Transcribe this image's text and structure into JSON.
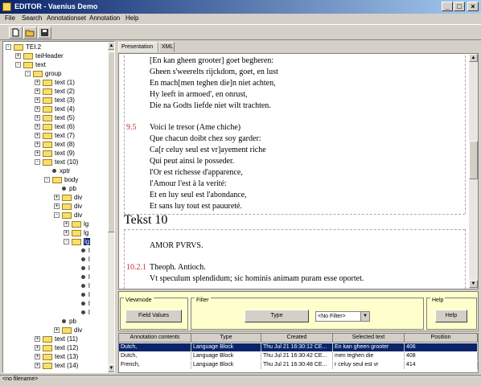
{
  "window": {
    "title": "EDITOR - Vaenius Demo"
  },
  "menu": [
    "File",
    "Search",
    "Annotationset",
    "Annotation",
    "Help"
  ],
  "tree": {
    "nodes": [
      {
        "label": "TEI.2",
        "depth": 0,
        "kind": "folder",
        "exp": "-"
      },
      {
        "label": "teiHeader",
        "depth": 1,
        "kind": "folder",
        "exp": "+"
      },
      {
        "label": "text",
        "depth": 1,
        "kind": "folder",
        "exp": "-"
      },
      {
        "label": "group",
        "depth": 2,
        "kind": "folder",
        "exp": "-"
      },
      {
        "label": "text (1)",
        "depth": 3,
        "kind": "folder",
        "exp": "+"
      },
      {
        "label": "text (2)",
        "depth": 3,
        "kind": "folder",
        "exp": "+"
      },
      {
        "label": "text (3)",
        "depth": 3,
        "kind": "folder",
        "exp": "+"
      },
      {
        "label": "text (4)",
        "depth": 3,
        "kind": "folder",
        "exp": "+"
      },
      {
        "label": "text (5)",
        "depth": 3,
        "kind": "folder",
        "exp": "+"
      },
      {
        "label": "text (6)",
        "depth": 3,
        "kind": "folder",
        "exp": "+"
      },
      {
        "label": "text (7)",
        "depth": 3,
        "kind": "folder",
        "exp": "+"
      },
      {
        "label": "text (8)",
        "depth": 3,
        "kind": "folder",
        "exp": "+"
      },
      {
        "label": "text (9)",
        "depth": 3,
        "kind": "folder",
        "exp": "+"
      },
      {
        "label": "text (10)",
        "depth": 3,
        "kind": "folder",
        "exp": "-"
      },
      {
        "label": "xptr",
        "depth": 4,
        "kind": "leaf",
        "exp": ""
      },
      {
        "label": "body",
        "depth": 4,
        "kind": "folder",
        "exp": "-"
      },
      {
        "label": "pb",
        "depth": 5,
        "kind": "leaf",
        "exp": ""
      },
      {
        "label": "div",
        "depth": 5,
        "kind": "folder",
        "exp": "+"
      },
      {
        "label": "div",
        "depth": 5,
        "kind": "folder",
        "exp": "+"
      },
      {
        "label": "div",
        "depth": 5,
        "kind": "folder",
        "exp": "-"
      },
      {
        "label": "lg",
        "depth": 6,
        "kind": "folder",
        "exp": "+"
      },
      {
        "label": "lg",
        "depth": 6,
        "kind": "folder",
        "exp": "+"
      },
      {
        "label": "lg",
        "depth": 6,
        "kind": "folder",
        "exp": "-",
        "selected": true
      },
      {
        "label": "l",
        "depth": 7,
        "kind": "leaf",
        "exp": ""
      },
      {
        "label": "l",
        "depth": 7,
        "kind": "leaf",
        "exp": ""
      },
      {
        "label": "l",
        "depth": 7,
        "kind": "leaf",
        "exp": ""
      },
      {
        "label": "l",
        "depth": 7,
        "kind": "leaf",
        "exp": ""
      },
      {
        "label": "l",
        "depth": 7,
        "kind": "leaf",
        "exp": ""
      },
      {
        "label": "l",
        "depth": 7,
        "kind": "leaf",
        "exp": ""
      },
      {
        "label": "l",
        "depth": 7,
        "kind": "leaf",
        "exp": ""
      },
      {
        "label": "l",
        "depth": 7,
        "kind": "leaf",
        "exp": ""
      },
      {
        "label": "pb",
        "depth": 5,
        "kind": "leaf",
        "exp": ""
      },
      {
        "label": "div",
        "depth": 5,
        "kind": "folder",
        "exp": "+"
      },
      {
        "label": "text (11)",
        "depth": 3,
        "kind": "folder",
        "exp": "+"
      },
      {
        "label": "text (12)",
        "depth": 3,
        "kind": "folder",
        "exp": "+"
      },
      {
        "label": "text (13)",
        "depth": 3,
        "kind": "folder",
        "exp": "+"
      },
      {
        "label": "text (14)",
        "depth": 3,
        "kind": "folder",
        "exp": "+"
      }
    ]
  },
  "tabs": [
    "Presentation",
    "XML"
  ],
  "document": {
    "block1": [
      "[En kan gheen grooter] goet begheren:",
      "Gheen s'weerelts rijckdom, goet, en lust",
      "En mach[men teghen die]n niet achten,",
      "Hy leeft in armoed', en onrust,",
      "Die na Godts liefde niet wilt trachten."
    ],
    "num95": "9.5",
    "block2": [
      "Voici le tresor (Ame chiche)",
      "Que chacun doibt chez soy garder:",
      "Ca[r celuy seul est vr]ayement riche",
      "Qui peut ainsi le posseder.",
      "l'Or est richesse d'apparence,",
      "l'Amour l'est à la verité:",
      "Et en luy seul est l'abondance,",
      "Et sans luy tout est pauureté."
    ],
    "heading": "Tekst 10",
    "motto": "AMOR PVRVS.",
    "num1021": "10.2.1",
    "line_theoph": "Theoph. Antioch.",
    "line_vt": "Vt speculum splendidum; sic hominis animam puram esse oportet."
  },
  "panels": {
    "viewmode": {
      "label": "Viewmode",
      "button": "Field Values"
    },
    "filter": {
      "label": "Filter",
      "button": "Type",
      "select_value": "<No Filter>"
    },
    "help": {
      "label": "Help",
      "button": "Help"
    }
  },
  "table": {
    "headers": [
      "Annotation contents",
      "Type",
      "Created",
      "Selected text",
      "Position"
    ],
    "rows": [
      [
        "Dutch,",
        "Language Block",
        "Thu Jul 21 16:30:12 CE...",
        "En kan gheen grooter",
        "406"
      ],
      [
        "Dutch,",
        "Language Block",
        "Thu Jul 21 16:30:42 CE...",
        "men teghen die",
        "408"
      ],
      [
        "French,",
        "Language Block",
        "Thu Jul 21 16:30:48 CE...",
        "r celuy seul est vr",
        "414"
      ]
    ]
  },
  "status": "<no filename>",
  "colors": {
    "titlebar": "#0a246a",
    "selection": "#0a246a",
    "annotation_panel": "#ffffcc",
    "line_number": "#c03030"
  }
}
